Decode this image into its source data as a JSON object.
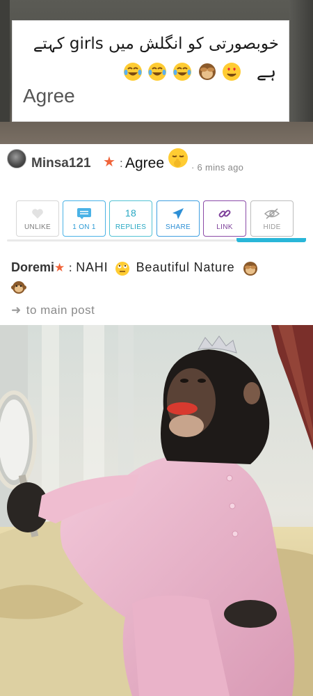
{
  "top_post": {
    "urdu_text": "خوبصورتی کو انگلش میں girls کہتے",
    "urdu_line2_char": "ہے",
    "caption_agree": "Agree",
    "emojis": [
      "laughing-tears",
      "laughing-tears",
      "laughing-tears",
      "see-no-evil-monkey",
      "heart-eyes"
    ]
  },
  "comment": {
    "username": "Minsa121",
    "colon": ":",
    "text": "Agree",
    "emoji": "shushing-face",
    "time": "· 6 mins ago"
  },
  "actions": {
    "unlike": "UNLIKE",
    "one_on_one": "1 ON 1",
    "replies_count": "18",
    "replies": "REPLIES",
    "share": "SHARE",
    "link": "LINK",
    "hide": "HIDE"
  },
  "reply": {
    "username": "Doremi",
    "colon": ":",
    "text": "NAHI",
    "text2": "Beautiful Nature",
    "emojis": [
      "eye-roll-face",
      "see-no-evil-monkey",
      "monkey-face"
    ]
  },
  "main_post_link": "to main post",
  "colors": {
    "star": "#f0643a",
    "accent_blue": "#2d9bd5",
    "accent_teal": "#29b6d8",
    "link_purple": "#7d3f9a"
  }
}
